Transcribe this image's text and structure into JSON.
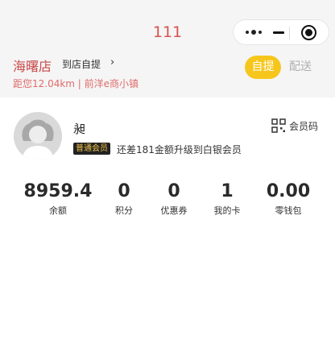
{
  "nav": {
    "title": "111"
  },
  "capsule": {
    "more_icon": "more-dots-icon",
    "minimize_icon": "minimize-icon",
    "close_icon": "close-circle-icon"
  },
  "store": {
    "name": "海曙店",
    "pickup_label": "到店自提",
    "chevron": "›",
    "distance": "距您12.04km | 前洋e商小镇"
  },
  "mode_toggle": {
    "self_pickup": "自提",
    "delivery": "配送",
    "active": "自提",
    "active_color": "#f7c61d"
  },
  "user": {
    "name": "昶",
    "badge": "普通会员",
    "upgrade_hint": "还差181金额升级到白银会员",
    "member_code_label": "会员码",
    "member_code_icon": "qr-code-icon",
    "avatar_icon": "default-avatar-icon"
  },
  "stats": [
    {
      "value": "8959.4",
      "label": "余额"
    },
    {
      "value": "0",
      "label": "积分"
    },
    {
      "value": "0",
      "label": "优惠券"
    },
    {
      "value": "1",
      "label": "我的卡"
    },
    {
      "value": "0.00",
      "label": "零钱包"
    }
  ],
  "colors": {
    "accent_red": "#c94b4b",
    "pickup_yellow": "#f7c61d",
    "header_bg": "#f5f5f5"
  }
}
